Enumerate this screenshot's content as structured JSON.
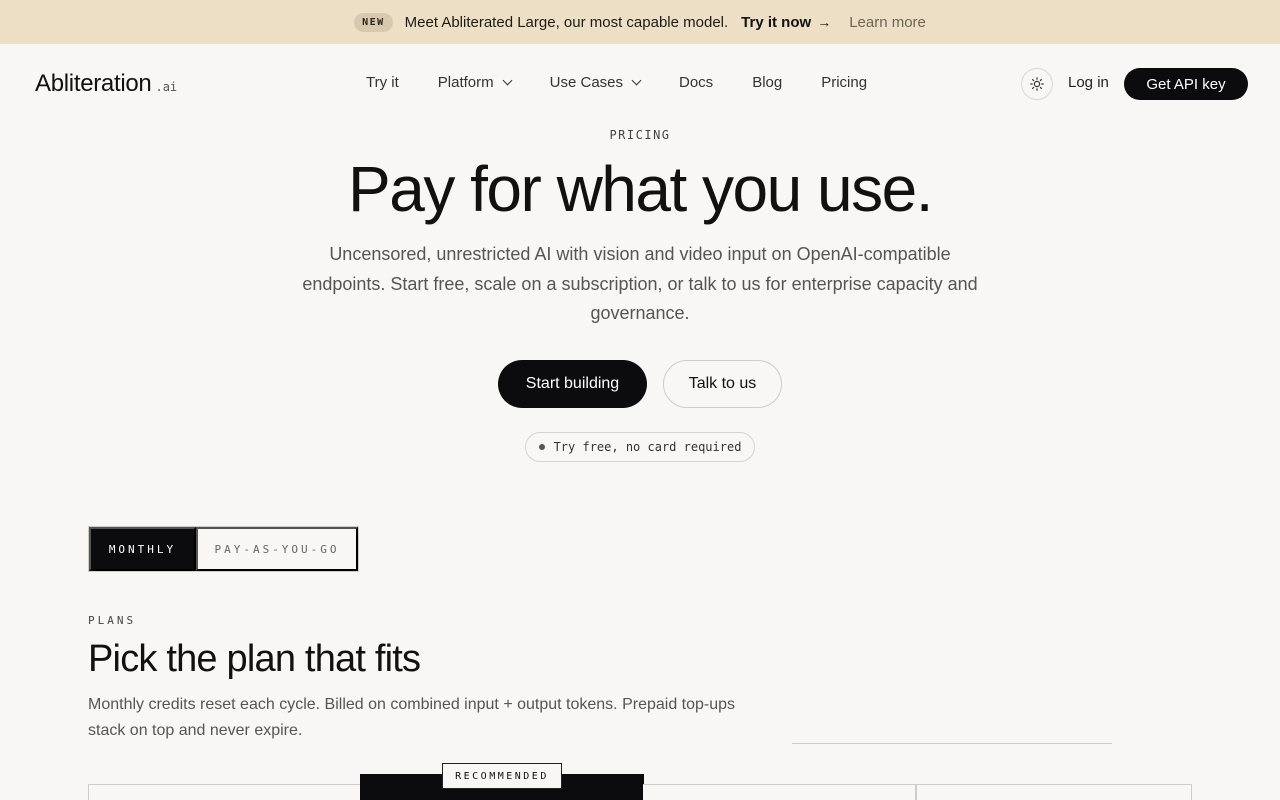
{
  "banner": {
    "badge": "NEW",
    "message": "Meet Abliterated Large, our most capable model.",
    "try_label": "Try it now",
    "learn_label": "Learn more"
  },
  "header": {
    "logo_word": "Abliteration",
    "logo_tld": ".ai",
    "nav": [
      {
        "label": "Try it",
        "dropdown": false
      },
      {
        "label": "Platform",
        "dropdown": true
      },
      {
        "label": "Use Cases",
        "dropdown": true
      },
      {
        "label": "Docs",
        "dropdown": false
      },
      {
        "label": "Blog",
        "dropdown": false
      },
      {
        "label": "Pricing",
        "dropdown": false
      }
    ],
    "theme_icon": "sun-icon",
    "login_label": "Log in",
    "api_button_label": "Get API key"
  },
  "hero": {
    "eyebrow": "PRICING",
    "title": "Pay for what you use.",
    "subtitle": "Uncensored, unrestricted AI with vision and video input on OpenAI-compatible endpoints. Start free, scale on a subscription, or talk to us for enterprise capacity and governance.",
    "primary_cta": "Start building",
    "secondary_cta": "Talk to us",
    "pill_text": "Try free, no card required"
  },
  "billing": {
    "options": [
      "MONTHLY",
      "PAY-AS-YOU-GO"
    ],
    "selected": "MONTHLY"
  },
  "plans": {
    "eyebrow": "PLANS",
    "title": "Pick the plan that fits",
    "subtitle": "Monthly credits reset each cycle. Billed on combined input + output tokens. Prepaid top-ups stack on top and never expire.",
    "recommended_badge": "RECOMMENDED"
  },
  "colors": {
    "banner_bg": "#ecdfc6",
    "page_bg": "#f8f7f5",
    "primary": "#0c0c0f"
  }
}
